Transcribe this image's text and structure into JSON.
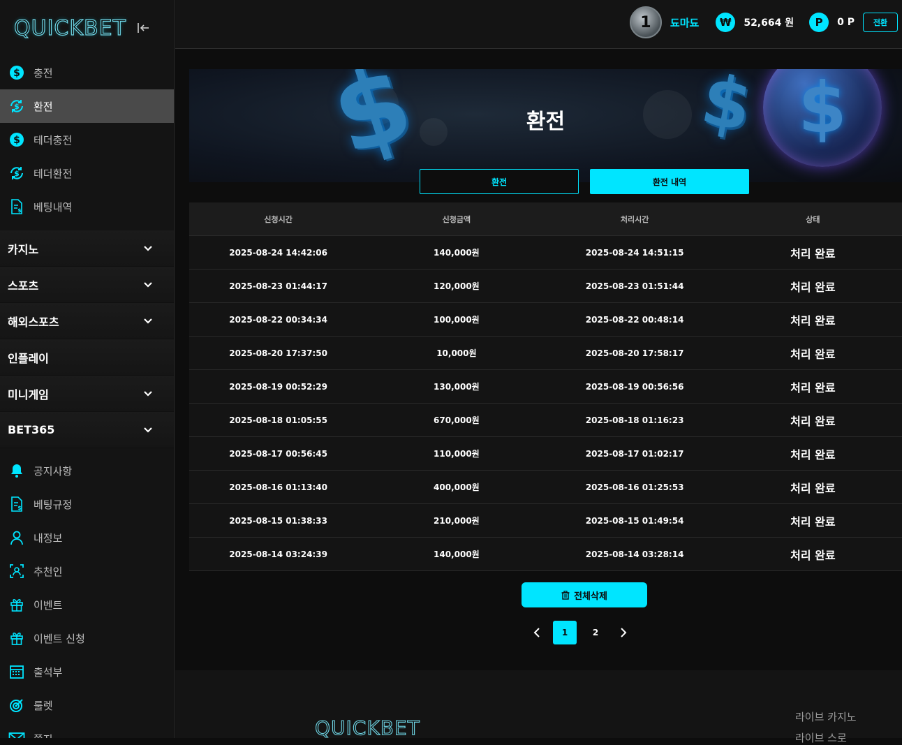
{
  "brand": {
    "logo": "QUICKBET"
  },
  "sidebar": {
    "top_items": [
      {
        "label": "충전",
        "icon": "dollar-circle-icon"
      },
      {
        "label": "환전",
        "icon": "exchange-dollar-icon",
        "active": true
      },
      {
        "label": "테더충전",
        "icon": "dollar-circle-icon"
      },
      {
        "label": "테더환전",
        "icon": "exchange-dollar-icon"
      },
      {
        "label": "베팅내역",
        "icon": "betting-document-icon"
      }
    ],
    "categories": [
      {
        "label": "카지노",
        "expandable": true
      },
      {
        "label": "스포츠",
        "expandable": true
      },
      {
        "label": "해외스포츠",
        "expandable": true
      },
      {
        "label": "인플레이",
        "expandable": false
      },
      {
        "label": "미니게임",
        "expandable": true
      },
      {
        "label": "BET365",
        "expandable": true
      }
    ],
    "bottom_items": [
      {
        "label": "공지사항",
        "icon": "bell-icon"
      },
      {
        "label": "베팅규정",
        "icon": "betting-document-icon"
      },
      {
        "label": "내정보",
        "icon": "user-icon"
      },
      {
        "label": "추천인",
        "icon": "referral-icon"
      },
      {
        "label": "이벤트",
        "icon": "gift-icon"
      },
      {
        "label": "이벤트 신청",
        "icon": "gift-icon"
      },
      {
        "label": "출석부",
        "icon": "calendar-icon"
      },
      {
        "label": "룰렛",
        "icon": "roulette-icon"
      },
      {
        "label": "쪽지",
        "icon": "mail-icon"
      }
    ]
  },
  "header": {
    "level": "1",
    "username": "됴마됴",
    "currency_symbol": "₩",
    "balance": "52,664 원",
    "points_symbol": "P",
    "points": "0 P",
    "convert_label": "전환"
  },
  "banner": {
    "title": "환전"
  },
  "tabs": [
    {
      "label": "환전",
      "active": false
    },
    {
      "label": "환전 내역",
      "active": true
    }
  ],
  "table": {
    "columns": [
      "신청시간",
      "신청금액",
      "처리시간",
      "상태"
    ],
    "rows": [
      [
        "2025-08-24 14:42:06",
        "140,000원",
        "2025-08-24 14:51:15",
        "처리 완료"
      ],
      [
        "2025-08-23 01:44:17",
        "120,000원",
        "2025-08-23 01:51:44",
        "처리 완료"
      ],
      [
        "2025-08-22 00:34:34",
        "100,000원",
        "2025-08-22 00:48:14",
        "처리 완료"
      ],
      [
        "2025-08-20 17:37:50",
        "10,000원",
        "2025-08-20 17:58:17",
        "처리 완료"
      ],
      [
        "2025-08-19 00:52:29",
        "130,000원",
        "2025-08-19 00:56:56",
        "처리 완료"
      ],
      [
        "2025-08-18 01:05:55",
        "670,000원",
        "2025-08-18 01:16:23",
        "처리 완료"
      ],
      [
        "2025-08-17 00:56:45",
        "110,000원",
        "2025-08-17 01:02:17",
        "처리 완료"
      ],
      [
        "2025-08-16 01:13:40",
        "400,000원",
        "2025-08-16 01:25:53",
        "처리 완료"
      ],
      [
        "2025-08-15 01:38:33",
        "210,000원",
        "2025-08-15 01:49:54",
        "처리 완료"
      ],
      [
        "2025-08-14 03:24:39",
        "140,000원",
        "2025-08-14 03:28:14",
        "처리 완료"
      ]
    ]
  },
  "delete_all_label": "전체삭제",
  "pagination": {
    "pages": [
      "1",
      "2"
    ],
    "current": "1"
  },
  "footer": {
    "logo": "QUICKBET",
    "links": [
      "라이브 카지노",
      "라이브 스로"
    ]
  },
  "colors": {
    "accent": "#00e5ff",
    "sidebar_bg": "#141414",
    "active_item_bg": "#4a4a4a"
  }
}
